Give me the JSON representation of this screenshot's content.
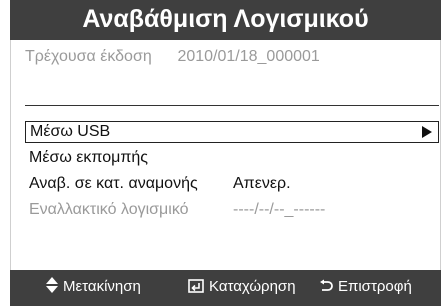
{
  "title": "Αναβάθμιση Λογισμικού",
  "current_version": {
    "label": "Τρέχουσα έκδοση",
    "value": "2010/01/18_000001"
  },
  "options": [
    {
      "label": "Μέσω USB",
      "value": "",
      "state": "selected",
      "icon": "right-arrow-icon"
    },
    {
      "label": "Μέσω εκπομπής",
      "value": "",
      "state": "normal"
    },
    {
      "label": "Αναβ. σε κατ. αναμονής",
      "value": "Απενερ.",
      "state": "normal"
    },
    {
      "label": "Εναλλακτικό λογισμικό",
      "value": "----/--/--_------",
      "state": "disabled"
    }
  ],
  "footer": {
    "move": {
      "icon": "up-down-arrows-icon",
      "label": "Μετακίνηση"
    },
    "enter": {
      "icon": "enter-icon",
      "label": "Καταχώρηση"
    },
    "return": {
      "icon": "return-icon",
      "label": "Επιστροφή"
    }
  }
}
